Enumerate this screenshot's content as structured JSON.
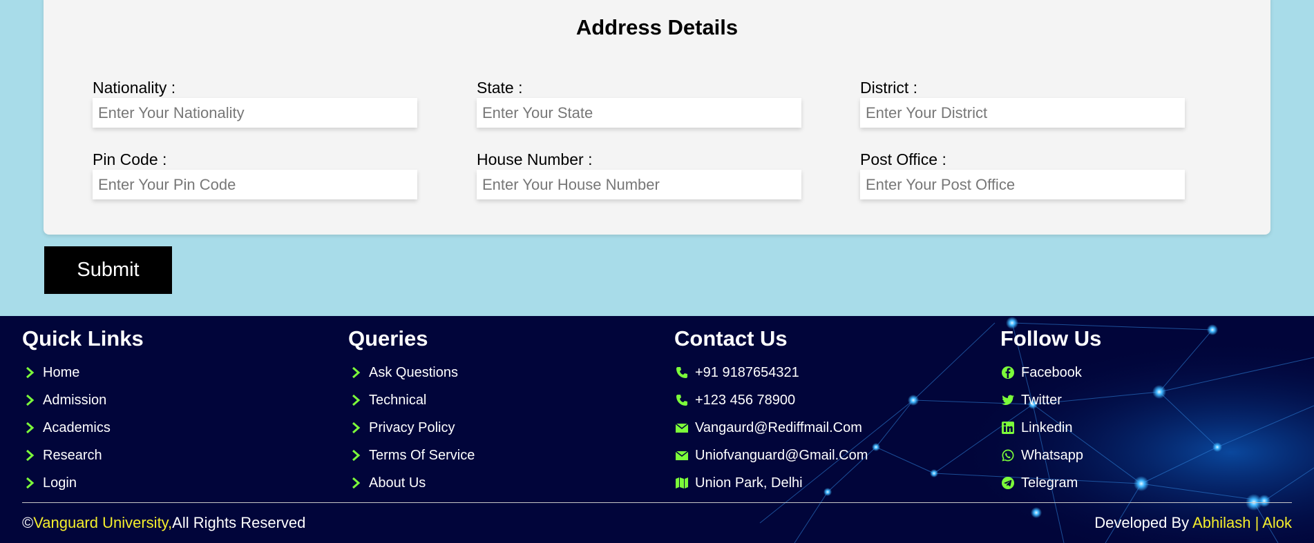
{
  "form": {
    "title": "Address Details",
    "fields": [
      {
        "label": "Nationality :",
        "placeholder": "Enter Your Nationality"
      },
      {
        "label": "State :",
        "placeholder": "Enter Your State"
      },
      {
        "label": "District :",
        "placeholder": "Enter Your District"
      },
      {
        "label": "Pin Code :",
        "placeholder": "Enter Your Pin Code"
      },
      {
        "label": "House Number :",
        "placeholder": "Enter Your House Number"
      },
      {
        "label": "Post Office :",
        "placeholder": "Enter Your Post Office"
      }
    ],
    "submit_label": "Submit"
  },
  "footer": {
    "quick_links": {
      "title": "Quick Links",
      "items": [
        "Home",
        "Admission",
        "Academics",
        "Research",
        "Login"
      ]
    },
    "queries": {
      "title": "Queries",
      "items": [
        "Ask Questions",
        "Technical",
        "Privacy Policy",
        "Terms Of Service",
        "About Us"
      ]
    },
    "contact": {
      "title": "Contact Us",
      "items": [
        {
          "icon": "phone-icon",
          "text": "+91 9187654321"
        },
        {
          "icon": "phone-icon",
          "text": "+123 456 78900"
        },
        {
          "icon": "envelope-icon",
          "text": "Vangaurd@Rediffmail.Com"
        },
        {
          "icon": "envelope-icon",
          "text": "Uniofvanguard@Gmail.Com"
        },
        {
          "icon": "map-icon",
          "text": "Union Park, Delhi"
        }
      ]
    },
    "follow": {
      "title": "Follow Us",
      "items": [
        {
          "icon": "facebook-icon",
          "text": "Facebook"
        },
        {
          "icon": "twitter-icon",
          "text": "Twitter"
        },
        {
          "icon": "linkedin-icon",
          "text": "Linkedin"
        },
        {
          "icon": "whatsapp-icon",
          "text": "Whatsapp"
        },
        {
          "icon": "telegram-icon",
          "text": "Telegram"
        }
      ]
    },
    "copyright": {
      "symbol": "©",
      "name": "Vanguard University,",
      "rest": "All Rights Reserved"
    },
    "developed": {
      "prefix": "Developed By ",
      "dev1": "Abhilash",
      "sep": " | ",
      "dev2": "Alok"
    }
  },
  "colors": {
    "page_bg": "#a8dce9",
    "footer_bg": "#01053a",
    "icon_green": "#7cfc3a",
    "highlight_yellow": "#f5ee2c"
  }
}
